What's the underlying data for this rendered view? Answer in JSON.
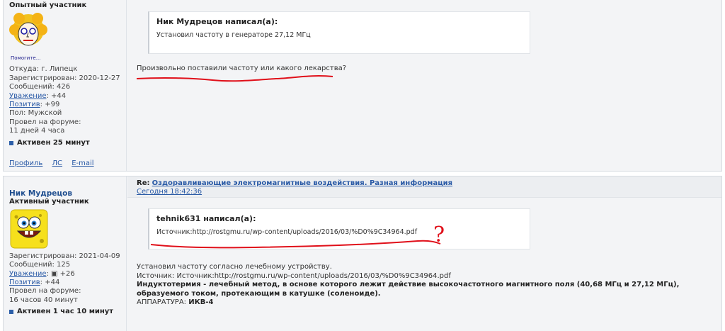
{
  "post1": {
    "rank": "Опытный участник",
    "avatar_text": "Помогите...",
    "location": "Откуда: г. Липецк",
    "registered": "Зарегистрирован: 2020-12-27",
    "messages": "Сообщений: 426",
    "respect_label": "Уважение",
    "respect_value": ": +44",
    "positive_label": "Позитив",
    "positive_value": ": +99",
    "gender": "Пол: Мужской",
    "forum_time_label": "Провел на форуме:",
    "forum_time_value": "11 дней 4 часа",
    "active": "Активен 25 минут",
    "links": [
      "Профиль",
      "ЛС",
      "E-mail"
    ],
    "quote_author": "Ник Мудрецов написал(а):",
    "quote_text": "Установил частоту в генераторе 27,12 МГц",
    "message": "Произвольно поставили частоту или какого лекарства?"
  },
  "post2": {
    "username": "Ник Мудрецов",
    "rank": "Активный участник",
    "registered": "Зарегистрирован: 2021-04-09",
    "messages": "Сообщений: 125",
    "respect_label": "Уважение",
    "respect_value": ": ▣ +26",
    "positive_label": "Позитив",
    "positive_value": ": +44",
    "forum_time_label": "Провел на форуме:",
    "forum_time_value": "16 часов 40 минут",
    "active": "Активен 1 час 10 минут",
    "re_label": "Re:",
    "topic": "Оздоравливающие электромагнитные воздействия. Разная информация",
    "date": "Сегодня 18:42:36",
    "quote_author": "tehnik631 написал(а):",
    "quote_text": "Источник:http://rostgmu.ru/wp-content/uploads/2016/03/%D0%9C34964.pdf",
    "annotation": "?",
    "line1": "Установил частоту согласно лечебному устройству.",
    "line2": "Источник: Источник:http://rostgmu.ru/wp-content/uploads/2016/03/%D0%9C34964.pdf",
    "bold_term": "Индуктотермия",
    "definition": " - лечебный метод, в основе которого лежит действие высокочастотного магнитного поля (40,68 МГц и 27,12 МГц), образуемого током, протекающим в катушке (соленоиде).",
    "apparatus_label": "АППАРАТУРА: ",
    "apparatus_value": "ИКВ-4"
  },
  "colors": {
    "accent": "#2a5aa6",
    "annotation": "#e0101a",
    "background": "#f3f4f6"
  }
}
